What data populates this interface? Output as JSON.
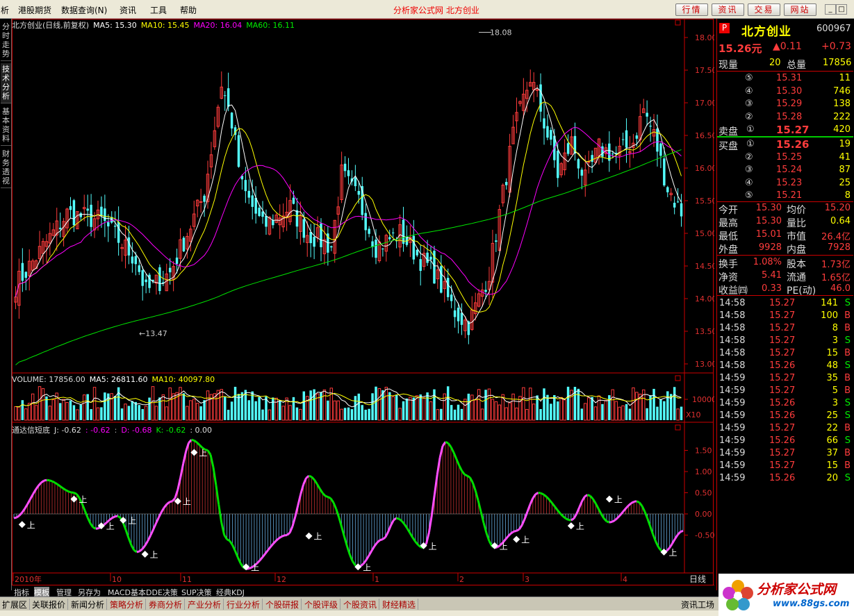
{
  "menubar": {
    "items": [
      "析",
      "港股期货",
      "数据查询(N)",
      "资讯",
      "工具",
      "帮助"
    ],
    "site_title": "分析家公式网 北方创业",
    "buttons": [
      "行情",
      "资讯",
      "交易",
      "网站"
    ],
    "win": [
      "_",
      "□",
      "×"
    ]
  },
  "left_tabs": [
    "分时走势",
    "技术分析",
    "基本资料",
    "财务透视"
  ],
  "price_chart": {
    "legend": {
      "name": "北方创业(日线,前复权)",
      "ma5": "MA5: 15.30",
      "ma10": "MA10: 15.45",
      "ma20": "MA20: 16.04",
      "ma60": "MA60: 16.11"
    },
    "y_ticks": [
      "18.00",
      "17.50",
      "17.00",
      "16.50",
      "16.00",
      "15.50",
      "15.00",
      "14.50",
      "14.00",
      "13.50",
      "13.00"
    ],
    "high_label": "18.08",
    "low_label": "13.47"
  },
  "volume_chart": {
    "legend": {
      "volume": "VOLUME: 17856.00",
      "ma5": "MA5: 26811.60",
      "ma10": "MA10: 40097.80"
    },
    "y_tick": "10000",
    "unit": "X10"
  },
  "kdj_chart": {
    "legend": {
      "name": "通达信短底",
      "j": "J: -0.62",
      "c1": ": -0.62",
      ":": ":",
      "d": "D: -0.68",
      "k": "K: -0.62",
      "z": ": 0.00"
    },
    "y_ticks": [
      "1.50",
      "1.00",
      "0.50",
      "0.00",
      "-0.50"
    ],
    "signal_label": "上"
  },
  "x_axis": {
    "labels": [
      "2010年",
      "10",
      "11",
      "12",
      "1",
      "2",
      "3",
      "4"
    ],
    "period": "日线"
  },
  "quote": {
    "code_badge": "P",
    "name": "北方创业",
    "code": "600967",
    "price": "15.26元",
    "change": "▲0.11",
    "change_pct": "+0.73",
    "xianliang_label": "现量",
    "xianliang": "20",
    "zongliang_label": "总量",
    "zongliang": "17856",
    "sell_label": "卖盘",
    "buy_label": "买盘",
    "asks": [
      [
        "⑤",
        "15.31",
        "11"
      ],
      [
        "④",
        "15.30",
        "746"
      ],
      [
        "③",
        "15.29",
        "138"
      ],
      [
        "②",
        "15.28",
        "222"
      ],
      [
        "①",
        "15.27",
        "420"
      ]
    ],
    "bids": [
      [
        "①",
        "15.26",
        "19"
      ],
      [
        "②",
        "15.25",
        "41"
      ],
      [
        "③",
        "15.24",
        "87"
      ],
      [
        "④",
        "15.23",
        "25"
      ],
      [
        "⑤",
        "15.21",
        "8"
      ]
    ],
    "stats": [
      [
        "今开",
        "15.30",
        "均价",
        "15.20"
      ],
      [
        "最高",
        "15.30",
        "量比",
        "0.64"
      ],
      [
        "最低",
        "15.01",
        "市值",
        "26.4亿"
      ],
      [
        "外盘",
        "9928",
        "内盘",
        "7928"
      ]
    ],
    "stats2": [
      [
        "换手",
        "1.08%",
        "股本",
        "1.73亿"
      ],
      [
        "净资",
        "5.41",
        "流通",
        "1.65亿"
      ],
      [
        "收益㈣",
        "0.33",
        "PE(动)",
        "46.0"
      ]
    ],
    "ticks": [
      [
        "14:58",
        "15.27",
        "141",
        "S"
      ],
      [
        "14:58",
        "15.27",
        "100",
        "B"
      ],
      [
        "14:58",
        "15.27",
        "8",
        "B"
      ],
      [
        "14:58",
        "15.27",
        "3",
        "S"
      ],
      [
        "14:58",
        "15.27",
        "15",
        "B"
      ],
      [
        "14:58",
        "15.26",
        "48",
        "S"
      ],
      [
        "14:59",
        "15.27",
        "35",
        "B"
      ],
      [
        "14:59",
        "15.27",
        "5",
        "B"
      ],
      [
        "14:59",
        "15.26",
        "3",
        "S"
      ],
      [
        "14:59",
        "15.26",
        "25",
        "S"
      ],
      [
        "14:59",
        "15.27",
        "22",
        "B"
      ],
      [
        "14:59",
        "15.26",
        "66",
        "S"
      ],
      [
        "14:59",
        "15.27",
        "37",
        "B"
      ],
      [
        "14:59",
        "15.27",
        "15",
        "B"
      ],
      [
        "14:59",
        "15.26",
        "20",
        "S"
      ]
    ]
  },
  "bottom_tabs": [
    "指标",
    "模板",
    "管理",
    "另存为",
    "MACD基本",
    "DDE决策",
    "SUP决策",
    "经典KDJ"
  ],
  "bottom_tabs2": [
    "扩展区",
    "关联报价",
    "新闻分析",
    "策略分析",
    "券商分析",
    "产业分析",
    "行业分析",
    "个股研报",
    "个股评级",
    "个股资讯",
    "财经精选"
  ],
  "status_right": "资讯工场",
  "logo": {
    "cn": "分析家公式网",
    "url": "www.88gs.com"
  },
  "colors": {
    "up": "#ff3c3c",
    "down": "#54ffff",
    "ma5": "#ffffff",
    "ma10": "#ffff00",
    "ma20": "#ff00ff",
    "ma60": "#00e600",
    "kdj_up": "#ff4fff",
    "kdj_down": "#00dd00"
  }
}
